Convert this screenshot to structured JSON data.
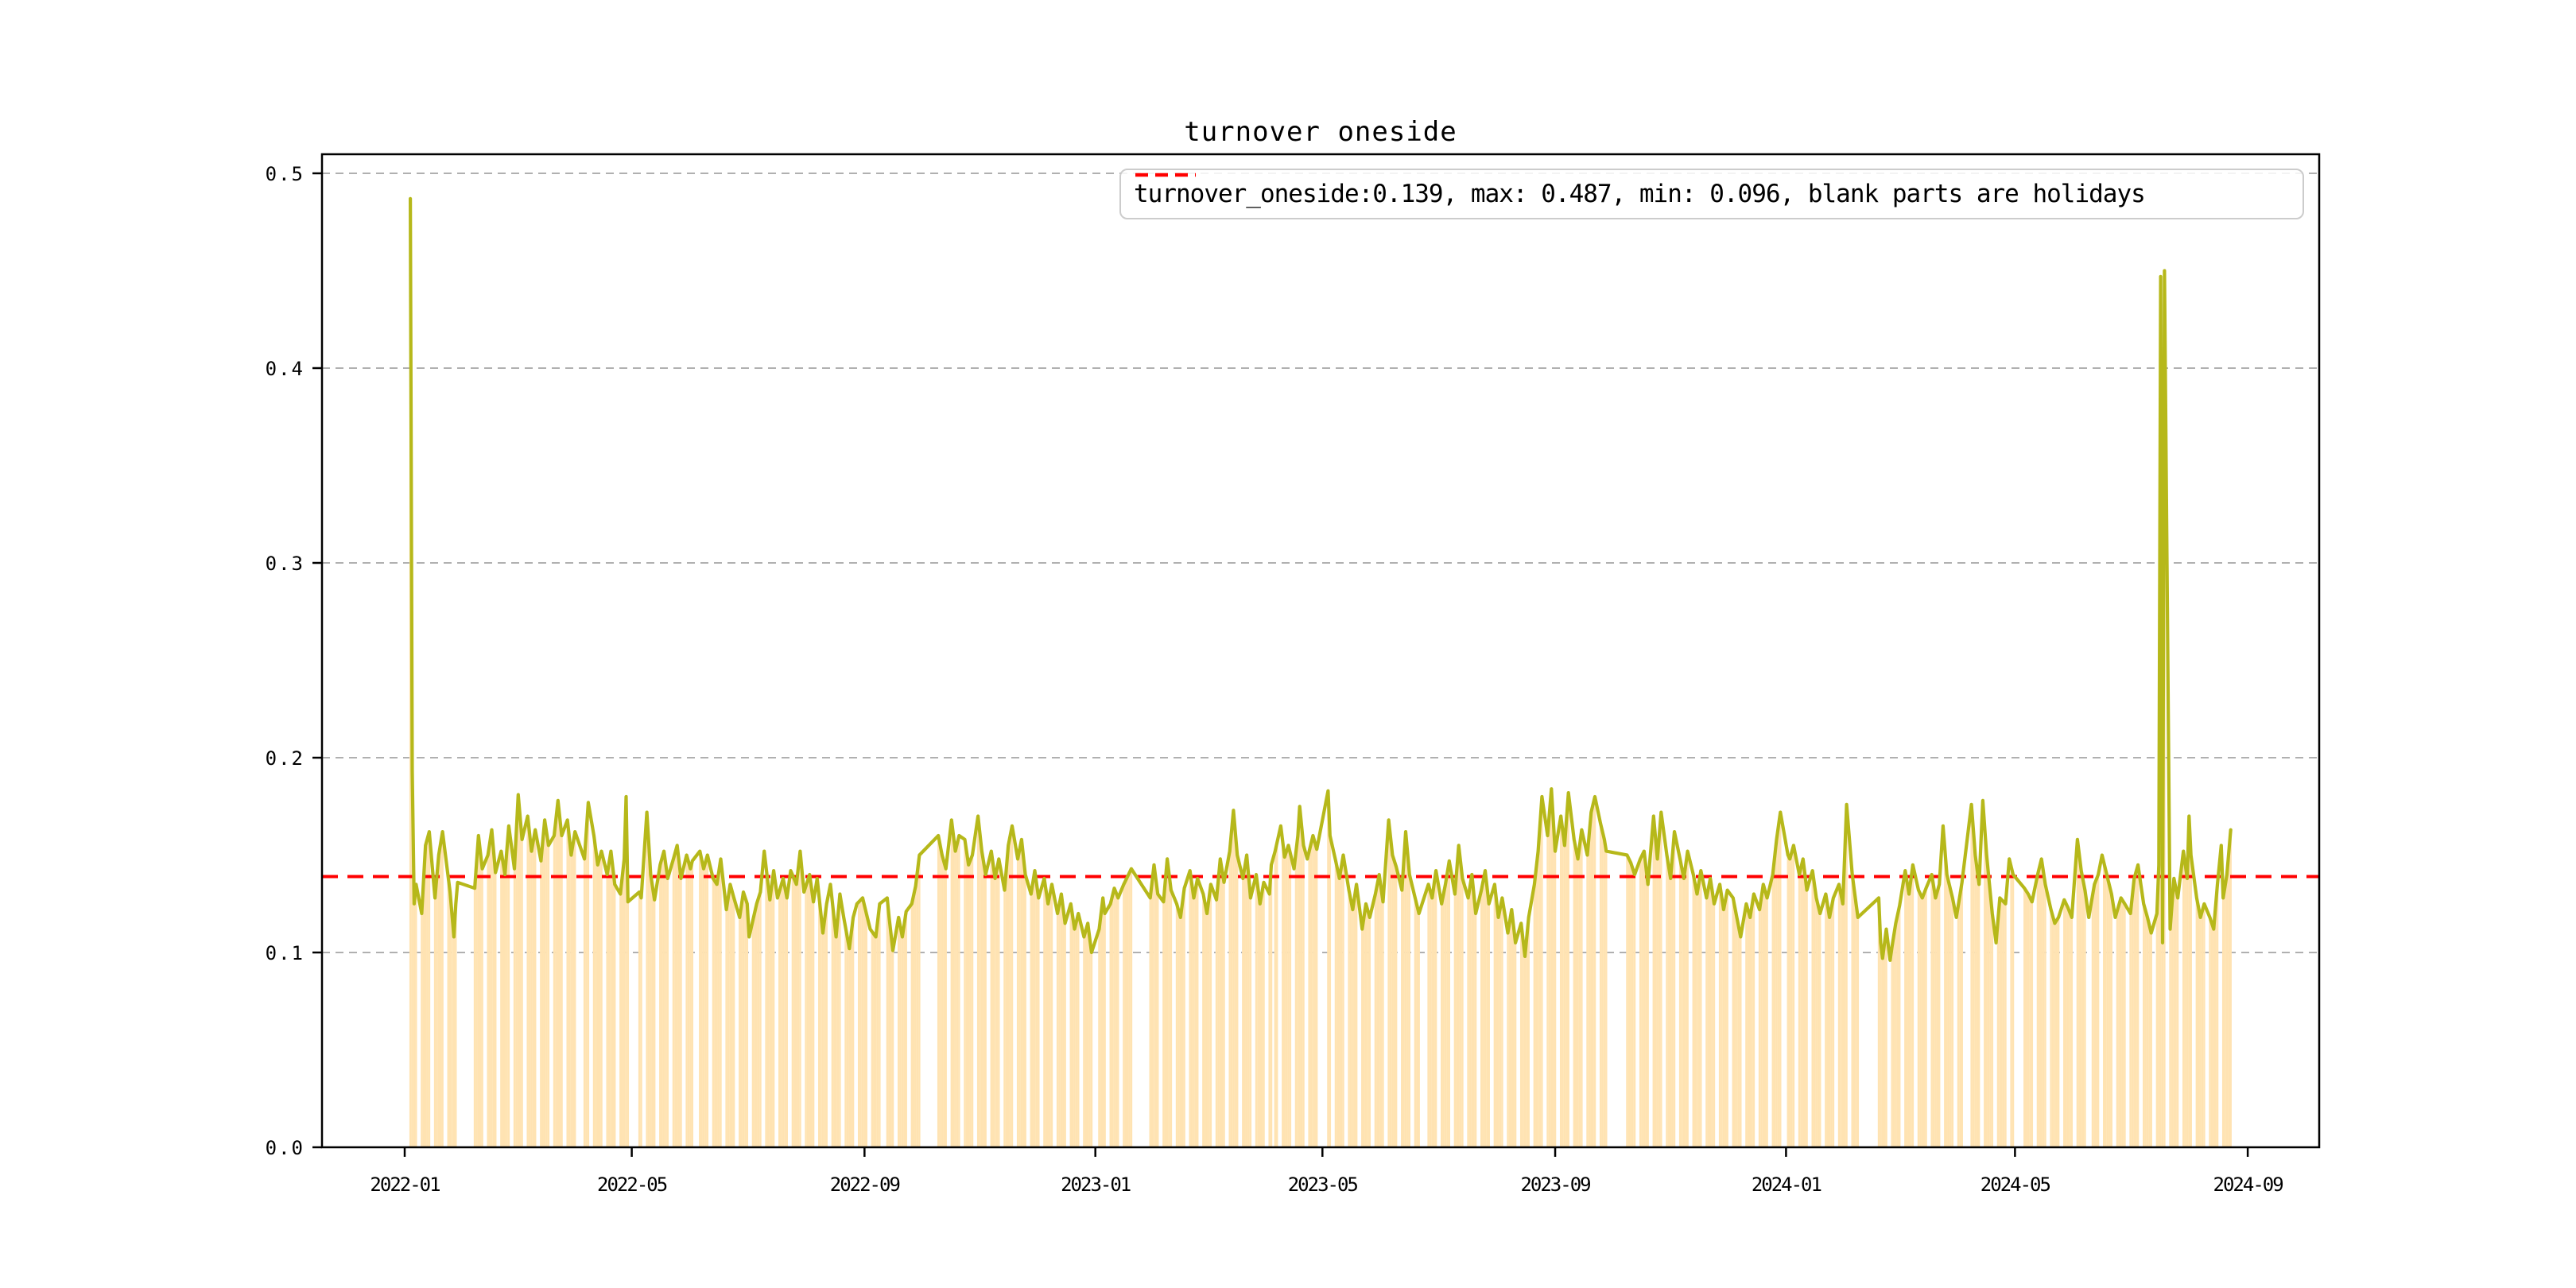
{
  "figure": {
    "title": "turnover oneside"
  },
  "legend": {
    "label": "turnover_oneside:0.139, max: 0.487, min: 0.096, blank parts are holidays",
    "marker_color": "#ff0000"
  },
  "chart_data": {
    "type": "line",
    "title": "turnover oneside",
    "series_name": "turnover_oneside",
    "mean": 0.139,
    "max": 0.487,
    "min": 0.096,
    "note": "blank parts are holidays",
    "x_unit": "days since 2022-01-01",
    "x_tick_labels": [
      "2022-01",
      "2022-05",
      "2022-09",
      "2023-01",
      "2023-05",
      "2023-09",
      "2024-01",
      "2024-05",
      "2024-09"
    ],
    "x_tick_days": [
      0,
      120,
      243,
      365,
      485,
      608,
      730,
      851,
      974
    ],
    "y_ticks": [
      "0.0",
      "0.1",
      "0.2",
      "0.3",
      "0.4",
      "0.5"
    ],
    "y_tick_values": [
      0.0,
      0.1,
      0.2,
      0.3,
      0.4,
      0.5
    ],
    "ylim": [
      0,
      0.51
    ],
    "grid": true,
    "legend_position": "upper right",
    "reference_line": {
      "value": 0.139,
      "style": "dashed",
      "color": "#ff0000"
    },
    "colors": {
      "line": "#b6b81a",
      "bar": "#ffe3b2",
      "grid": "#b0b0b0",
      "mean_line": "#ff0000",
      "frame": "#000000"
    },
    "holidays_day_ranges": [
      [
        0,
        2
      ],
      [
        30,
        36
      ],
      [
        92,
        94
      ],
      [
        119,
        123
      ],
      [
        153,
        153
      ],
      [
        252,
        254
      ],
      [
        273,
        281
      ],
      [
        364,
        366
      ],
      [
        385,
        392
      ],
      [
        459,
        459
      ],
      [
        483,
        487
      ],
      [
        537,
        539
      ],
      [
        636,
        645
      ],
      [
        728,
        730
      ],
      [
        769,
        778
      ],
      [
        824,
        826
      ],
      [
        851,
        855
      ],
      [
        891,
        891
      ]
    ],
    "points": [
      [
        3,
        0.487
      ],
      [
        4,
        0.193
      ],
      [
        5,
        0.125
      ],
      [
        6,
        0.135
      ],
      [
        9,
        0.12
      ],
      [
        11,
        0.155
      ],
      [
        13,
        0.162
      ],
      [
        16,
        0.128
      ],
      [
        18,
        0.15
      ],
      [
        20,
        0.162
      ],
      [
        24,
        0.131
      ],
      [
        26,
        0.108
      ],
      [
        27,
        0.125
      ],
      [
        28,
        0.136
      ],
      [
        37,
        0.133
      ],
      [
        39,
        0.16
      ],
      [
        41,
        0.143
      ],
      [
        44,
        0.15
      ],
      [
        46,
        0.163
      ],
      [
        48,
        0.141
      ],
      [
        51,
        0.152
      ],
      [
        53,
        0.14
      ],
      [
        55,
        0.165
      ],
      [
        58,
        0.143
      ],
      [
        60,
        0.181
      ],
      [
        62,
        0.158
      ],
      [
        65,
        0.17
      ],
      [
        67,
        0.152
      ],
      [
        69,
        0.163
      ],
      [
        72,
        0.147
      ],
      [
        74,
        0.168
      ],
      [
        76,
        0.155
      ],
      [
        79,
        0.16
      ],
      [
        81,
        0.178
      ],
      [
        83,
        0.16
      ],
      [
        86,
        0.168
      ],
      [
        88,
        0.15
      ],
      [
        90,
        0.162
      ],
      [
        95,
        0.148
      ],
      [
        97,
        0.177
      ],
      [
        100,
        0.16
      ],
      [
        102,
        0.145
      ],
      [
        104,
        0.152
      ],
      [
        107,
        0.14
      ],
      [
        109,
        0.152
      ],
      [
        111,
        0.135
      ],
      [
        114,
        0.13
      ],
      [
        116,
        0.148
      ],
      [
        117,
        0.18
      ],
      [
        118,
        0.126
      ],
      [
        124,
        0.131
      ],
      [
        125,
        0.128
      ],
      [
        128,
        0.172
      ],
      [
        130,
        0.14
      ],
      [
        132,
        0.127
      ],
      [
        135,
        0.145
      ],
      [
        137,
        0.152
      ],
      [
        139,
        0.138
      ],
      [
        142,
        0.148
      ],
      [
        144,
        0.155
      ],
      [
        146,
        0.138
      ],
      [
        149,
        0.15
      ],
      [
        151,
        0.143
      ],
      [
        152,
        0.147
      ],
      [
        156,
        0.152
      ],
      [
        158,
        0.143
      ],
      [
        160,
        0.15
      ],
      [
        163,
        0.138
      ],
      [
        165,
        0.135
      ],
      [
        167,
        0.148
      ],
      [
        170,
        0.122
      ],
      [
        172,
        0.135
      ],
      [
        174,
        0.128
      ],
      [
        177,
        0.118
      ],
      [
        179,
        0.131
      ],
      [
        181,
        0.125
      ],
      [
        182,
        0.108
      ],
      [
        186,
        0.125
      ],
      [
        188,
        0.131
      ],
      [
        190,
        0.152
      ],
      [
        193,
        0.127
      ],
      [
        195,
        0.142
      ],
      [
        197,
        0.128
      ],
      [
        200,
        0.138
      ],
      [
        202,
        0.128
      ],
      [
        204,
        0.142
      ],
      [
        207,
        0.135
      ],
      [
        209,
        0.152
      ],
      [
        211,
        0.131
      ],
      [
        214,
        0.14
      ],
      [
        216,
        0.126
      ],
      [
        218,
        0.138
      ],
      [
        221,
        0.11
      ],
      [
        223,
        0.125
      ],
      [
        225,
        0.135
      ],
      [
        228,
        0.108
      ],
      [
        230,
        0.13
      ],
      [
        232,
        0.118
      ],
      [
        235,
        0.102
      ],
      [
        237,
        0.118
      ],
      [
        239,
        0.125
      ],
      [
        242,
        0.128
      ],
      [
        244,
        0.12
      ],
      [
        246,
        0.112
      ],
      [
        249,
        0.108
      ],
      [
        251,
        0.125
      ],
      [
        255,
        0.128
      ],
      [
        256,
        0.118
      ],
      [
        258,
        0.101
      ],
      [
        261,
        0.118
      ],
      [
        263,
        0.108
      ],
      [
        265,
        0.121
      ],
      [
        268,
        0.125
      ],
      [
        270,
        0.134
      ],
      [
        272,
        0.15
      ],
      [
        282,
        0.16
      ],
      [
        284,
        0.15
      ],
      [
        286,
        0.143
      ],
      [
        289,
        0.168
      ],
      [
        291,
        0.152
      ],
      [
        293,
        0.16
      ],
      [
        296,
        0.158
      ],
      [
        298,
        0.145
      ],
      [
        300,
        0.15
      ],
      [
        303,
        0.17
      ],
      [
        305,
        0.152
      ],
      [
        307,
        0.14
      ],
      [
        310,
        0.152
      ],
      [
        312,
        0.138
      ],
      [
        314,
        0.148
      ],
      [
        317,
        0.132
      ],
      [
        319,
        0.155
      ],
      [
        321,
        0.165
      ],
      [
        324,
        0.148
      ],
      [
        326,
        0.158
      ],
      [
        328,
        0.14
      ],
      [
        331,
        0.13
      ],
      [
        333,
        0.142
      ],
      [
        335,
        0.128
      ],
      [
        338,
        0.138
      ],
      [
        340,
        0.125
      ],
      [
        342,
        0.135
      ],
      [
        345,
        0.12
      ],
      [
        347,
        0.13
      ],
      [
        349,
        0.115
      ],
      [
        352,
        0.125
      ],
      [
        354,
        0.112
      ],
      [
        356,
        0.12
      ],
      [
        359,
        0.108
      ],
      [
        361,
        0.115
      ],
      [
        363,
        0.1
      ],
      [
        367,
        0.112
      ],
      [
        369,
        0.128
      ],
      [
        370,
        0.12
      ],
      [
        373,
        0.125
      ],
      [
        375,
        0.133
      ],
      [
        377,
        0.128
      ],
      [
        380,
        0.135
      ],
      [
        382,
        0.139
      ],
      [
        384,
        0.143
      ],
      [
        394,
        0.128
      ],
      [
        396,
        0.145
      ],
      [
        398,
        0.13
      ],
      [
        401,
        0.126
      ],
      [
        403,
        0.148
      ],
      [
        405,
        0.132
      ],
      [
        408,
        0.125
      ],
      [
        410,
        0.118
      ],
      [
        412,
        0.133
      ],
      [
        415,
        0.142
      ],
      [
        417,
        0.128
      ],
      [
        419,
        0.138
      ],
      [
        422,
        0.13
      ],
      [
        424,
        0.12
      ],
      [
        426,
        0.135
      ],
      [
        429,
        0.127
      ],
      [
        431,
        0.148
      ],
      [
        433,
        0.136
      ],
      [
        436,
        0.152
      ],
      [
        438,
        0.173
      ],
      [
        440,
        0.15
      ],
      [
        443,
        0.138
      ],
      [
        445,
        0.15
      ],
      [
        447,
        0.128
      ],
      [
        450,
        0.14
      ],
      [
        452,
        0.125
      ],
      [
        454,
        0.136
      ],
      [
        457,
        0.13
      ],
      [
        458,
        0.145
      ],
      [
        460,
        0.152
      ],
      [
        463,
        0.165
      ],
      [
        465,
        0.149
      ],
      [
        467,
        0.155
      ],
      [
        470,
        0.143
      ],
      [
        472,
        0.16
      ],
      [
        473,
        0.175
      ],
      [
        475,
        0.155
      ],
      [
        477,
        0.148
      ],
      [
        480,
        0.16
      ],
      [
        482,
        0.153
      ],
      [
        488,
        0.183
      ],
      [
        489,
        0.16
      ],
      [
        492,
        0.147
      ],
      [
        494,
        0.138
      ],
      [
        496,
        0.15
      ],
      [
        499,
        0.132
      ],
      [
        501,
        0.122
      ],
      [
        503,
        0.135
      ],
      [
        506,
        0.112
      ],
      [
        508,
        0.125
      ],
      [
        510,
        0.118
      ],
      [
        513,
        0.13
      ],
      [
        515,
        0.14
      ],
      [
        517,
        0.126
      ],
      [
        520,
        0.168
      ],
      [
        522,
        0.15
      ],
      [
        524,
        0.144
      ],
      [
        527,
        0.132
      ],
      [
        529,
        0.162
      ],
      [
        531,
        0.14
      ],
      [
        534,
        0.128
      ],
      [
        536,
        0.12
      ],
      [
        541,
        0.135
      ],
      [
        543,
        0.128
      ],
      [
        545,
        0.142
      ],
      [
        548,
        0.125
      ],
      [
        550,
        0.135
      ],
      [
        552,
        0.147
      ],
      [
        555,
        0.13
      ],
      [
        557,
        0.155
      ],
      [
        559,
        0.138
      ],
      [
        562,
        0.128
      ],
      [
        564,
        0.14
      ],
      [
        566,
        0.12
      ],
      [
        569,
        0.132
      ],
      [
        571,
        0.142
      ],
      [
        573,
        0.125
      ],
      [
        576,
        0.135
      ],
      [
        578,
        0.118
      ],
      [
        580,
        0.128
      ],
      [
        583,
        0.11
      ],
      [
        585,
        0.122
      ],
      [
        587,
        0.105
      ],
      [
        590,
        0.115
      ],
      [
        592,
        0.098
      ],
      [
        594,
        0.118
      ],
      [
        597,
        0.135
      ],
      [
        599,
        0.152
      ],
      [
        601,
        0.18
      ],
      [
        604,
        0.16
      ],
      [
        606,
        0.184
      ],
      [
        608,
        0.152
      ],
      [
        611,
        0.17
      ],
      [
        613,
        0.155
      ],
      [
        615,
        0.182
      ],
      [
        618,
        0.158
      ],
      [
        620,
        0.148
      ],
      [
        622,
        0.163
      ],
      [
        625,
        0.15
      ],
      [
        627,
        0.172
      ],
      [
        629,
        0.18
      ],
      [
        632,
        0.166
      ],
      [
        634,
        0.158
      ],
      [
        635,
        0.152
      ],
      [
        646,
        0.15
      ],
      [
        648,
        0.146
      ],
      [
        650,
        0.14
      ],
      [
        653,
        0.148
      ],
      [
        655,
        0.152
      ],
      [
        657,
        0.135
      ],
      [
        660,
        0.17
      ],
      [
        662,
        0.148
      ],
      [
        664,
        0.172
      ],
      [
        667,
        0.15
      ],
      [
        669,
        0.138
      ],
      [
        671,
        0.162
      ],
      [
        674,
        0.148
      ],
      [
        676,
        0.138
      ],
      [
        678,
        0.152
      ],
      [
        681,
        0.14
      ],
      [
        683,
        0.13
      ],
      [
        685,
        0.142
      ],
      [
        688,
        0.128
      ],
      [
        690,
        0.138
      ],
      [
        692,
        0.125
      ],
      [
        695,
        0.135
      ],
      [
        697,
        0.122
      ],
      [
        699,
        0.132
      ],
      [
        702,
        0.128
      ],
      [
        704,
        0.118
      ],
      [
        706,
        0.108
      ],
      [
        709,
        0.125
      ],
      [
        711,
        0.118
      ],
      [
        713,
        0.13
      ],
      [
        716,
        0.122
      ],
      [
        718,
        0.135
      ],
      [
        720,
        0.128
      ],
      [
        723,
        0.14
      ],
      [
        725,
        0.158
      ],
      [
        727,
        0.172
      ],
      [
        731,
        0.15
      ],
      [
        732,
        0.148
      ],
      [
        734,
        0.155
      ],
      [
        737,
        0.14
      ],
      [
        739,
        0.148
      ],
      [
        741,
        0.132
      ],
      [
        744,
        0.142
      ],
      [
        746,
        0.128
      ],
      [
        748,
        0.12
      ],
      [
        751,
        0.13
      ],
      [
        753,
        0.118
      ],
      [
        755,
        0.128
      ],
      [
        758,
        0.135
      ],
      [
        760,
        0.125
      ],
      [
        761,
        0.15
      ],
      [
        762,
        0.176
      ],
      [
        765,
        0.14
      ],
      [
        767,
        0.125
      ],
      [
        768,
        0.118
      ],
      [
        779,
        0.128
      ],
      [
        780,
        0.105
      ],
      [
        781,
        0.097
      ],
      [
        783,
        0.112
      ],
      [
        785,
        0.096
      ],
      [
        786,
        0.103
      ],
      [
        788,
        0.115
      ],
      [
        790,
        0.124
      ],
      [
        793,
        0.142
      ],
      [
        795,
        0.13
      ],
      [
        797,
        0.145
      ],
      [
        800,
        0.132
      ],
      [
        802,
        0.128
      ],
      [
        804,
        0.133
      ],
      [
        807,
        0.14
      ],
      [
        809,
        0.128
      ],
      [
        811,
        0.135
      ],
      [
        813,
        0.165
      ],
      [
        815,
        0.14
      ],
      [
        818,
        0.128
      ],
      [
        820,
        0.118
      ],
      [
        822,
        0.13
      ],
      [
        823,
        0.136
      ],
      [
        828,
        0.176
      ],
      [
        830,
        0.15
      ],
      [
        832,
        0.135
      ],
      [
        834,
        0.178
      ],
      [
        836,
        0.15
      ],
      [
        839,
        0.12
      ],
      [
        841,
        0.105
      ],
      [
        843,
        0.128
      ],
      [
        846,
        0.125
      ],
      [
        848,
        0.148
      ],
      [
        850,
        0.14
      ],
      [
        856,
        0.133
      ],
      [
        858,
        0.13
      ],
      [
        860,
        0.126
      ],
      [
        863,
        0.14
      ],
      [
        865,
        0.148
      ],
      [
        867,
        0.135
      ],
      [
        870,
        0.122
      ],
      [
        872,
        0.115
      ],
      [
        874,
        0.118
      ],
      [
        877,
        0.127
      ],
      [
        879,
        0.123
      ],
      [
        881,
        0.118
      ],
      [
        884,
        0.158
      ],
      [
        886,
        0.142
      ],
      [
        888,
        0.132
      ],
      [
        890,
        0.118
      ],
      [
        893,
        0.135
      ],
      [
        895,
        0.14
      ],
      [
        897,
        0.15
      ],
      [
        900,
        0.138
      ],
      [
        902,
        0.13
      ],
      [
        904,
        0.118
      ],
      [
        907,
        0.128
      ],
      [
        909,
        0.125
      ],
      [
        912,
        0.12
      ],
      [
        914,
        0.138
      ],
      [
        916,
        0.145
      ],
      [
        919,
        0.125
      ],
      [
        921,
        0.118
      ],
      [
        923,
        0.11
      ],
      [
        926,
        0.12
      ],
      [
        927,
        0.145
      ],
      [
        928,
        0.447
      ],
      [
        929,
        0.105
      ],
      [
        930,
        0.45
      ],
      [
        933,
        0.112
      ],
      [
        935,
        0.138
      ],
      [
        937,
        0.128
      ],
      [
        940,
        0.152
      ],
      [
        942,
        0.138
      ],
      [
        943,
        0.17
      ],
      [
        944,
        0.15
      ],
      [
        947,
        0.128
      ],
      [
        949,
        0.118
      ],
      [
        951,
        0.125
      ],
      [
        954,
        0.118
      ],
      [
        956,
        0.112
      ],
      [
        958,
        0.135
      ],
      [
        960,
        0.155
      ],
      [
        961,
        0.128
      ],
      [
        963,
        0.14
      ],
      [
        965,
        0.163
      ]
    ]
  }
}
